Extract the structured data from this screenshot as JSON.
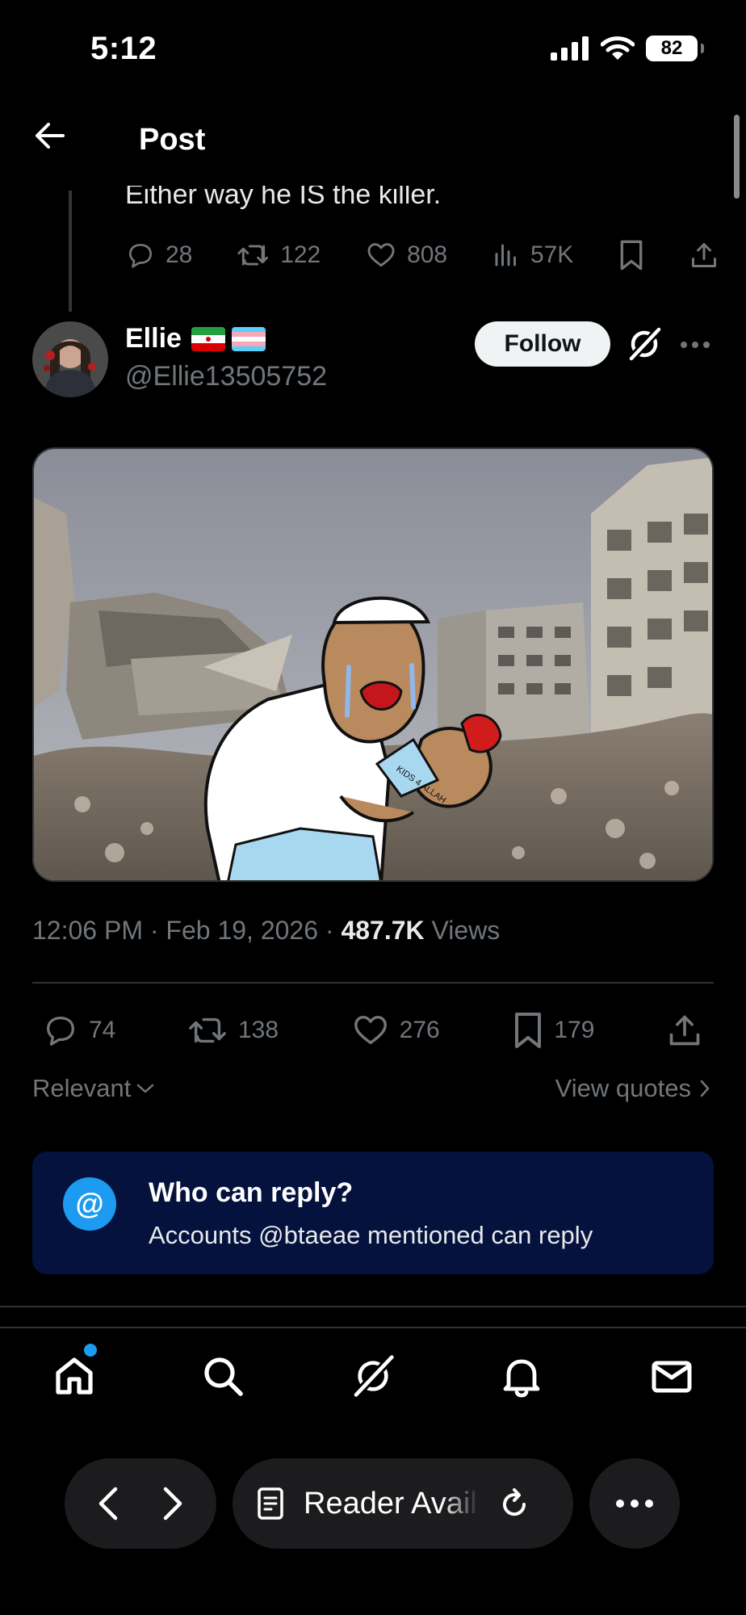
{
  "status_bar": {
    "time": "5:12",
    "battery": "82"
  },
  "header": {
    "title": "Post"
  },
  "previous_post": {
    "text": "Either way he IS the killer.",
    "replies": "28",
    "reposts": "122",
    "likes": "808",
    "views": "57K"
  },
  "post": {
    "author_name": "Ellie",
    "author_handle": "@Ellie13505752",
    "follow_label": "Follow",
    "image_text": "KIDS 4 ALLAH",
    "time": "12:06 PM",
    "date": "Feb 19, 2026",
    "views_count": "487.7K",
    "views_label": "Views",
    "replies": "74",
    "reposts": "138",
    "likes": "276",
    "bookmarks": "179"
  },
  "sort": {
    "label": "Relevant",
    "view_quotes": "View quotes"
  },
  "reply_restriction": {
    "badge": "@",
    "title": "Who can reply?",
    "subtitle": "Accounts @btaeae mentioned can reply"
  },
  "bottom_nav": [
    "home-icon",
    "search-icon",
    "grok-icon",
    "bell-icon",
    "mail-icon"
  ],
  "browser": {
    "url_text": "Reader Available"
  },
  "colors": {
    "accent": "#1d9bf0",
    "muted": "#71767b",
    "card_bg": "#04123d"
  }
}
